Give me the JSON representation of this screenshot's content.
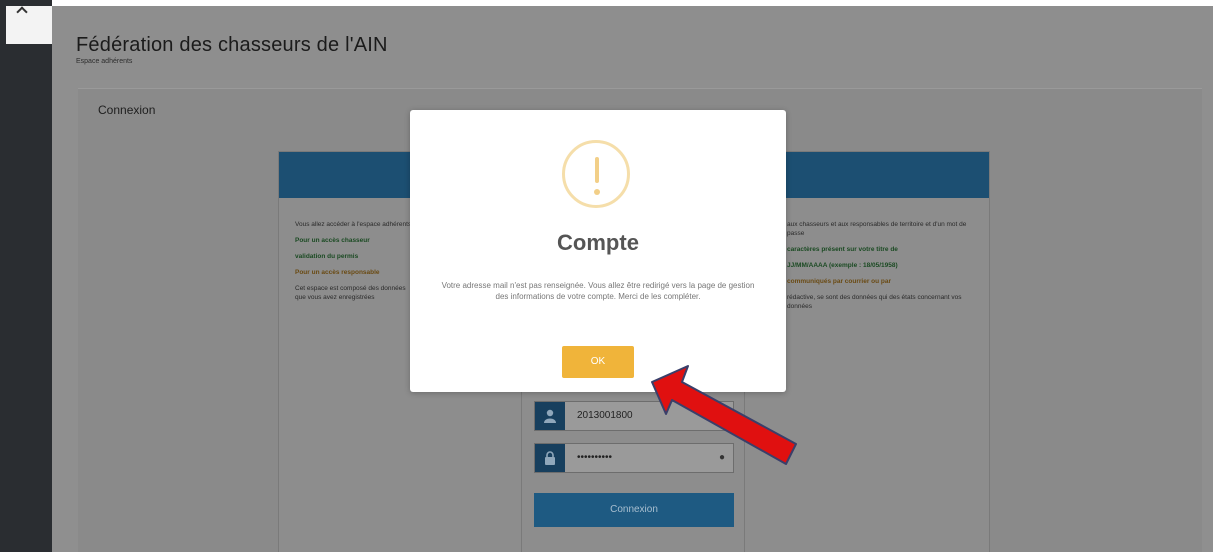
{
  "header": {
    "title": "Fédération des chasseurs de l'AIN",
    "subtitle": "Espace adhérents"
  },
  "section": {
    "title": "Connexion"
  },
  "card": {
    "left_col": [
      {
        "text": "Vous allez accéder à l'espace adhérents",
        "style": "normal"
      },
      {
        "text": "Pour un accès chasseur",
        "style": "green"
      },
      {
        "text": "validation du permis",
        "style": "green"
      },
      {
        "text": "Pour un accès responsable",
        "style": "orange"
      },
      {
        "text": "Cet espace est composé des données que vous avez enregistrées",
        "style": "normal"
      }
    ],
    "right_col": [
      {
        "text": "aux chasseurs et aux responsables de territoire et d'un mot de passe",
        "style": "normal"
      },
      {
        "text": "caractères présent sur votre titre de",
        "style": "green"
      },
      {
        "text": "JJ/MM/AAAA (exemple : 18/05/1958)",
        "style": "green"
      },
      {
        "text": "communiqués par courrier ou par",
        "style": "orange"
      },
      {
        "text": "rédactive, se sont des données qui des états concernant vos données",
        "style": "normal"
      }
    ]
  },
  "login": {
    "username_value": "2013001800",
    "password_value": "••••••••••",
    "submit_label": "Connexion"
  },
  "modal": {
    "title": "Compte",
    "message": "Votre adresse mail n'est pas renseignée. Vous allez être redirigé vers la page de gestion des informations de votre compte. Merci de les compléter.",
    "ok_label": "OK"
  },
  "colors": {
    "accent": "#f0b43a",
    "brand_blue": "#1e5a82",
    "warning_icon": "#f5deaa",
    "annotation_arrow": "#e01010"
  },
  "icons": {
    "warning": "exclamation-circle-icon",
    "user": "user-icon",
    "lock": "lock-icon",
    "eye": "eye-icon"
  }
}
